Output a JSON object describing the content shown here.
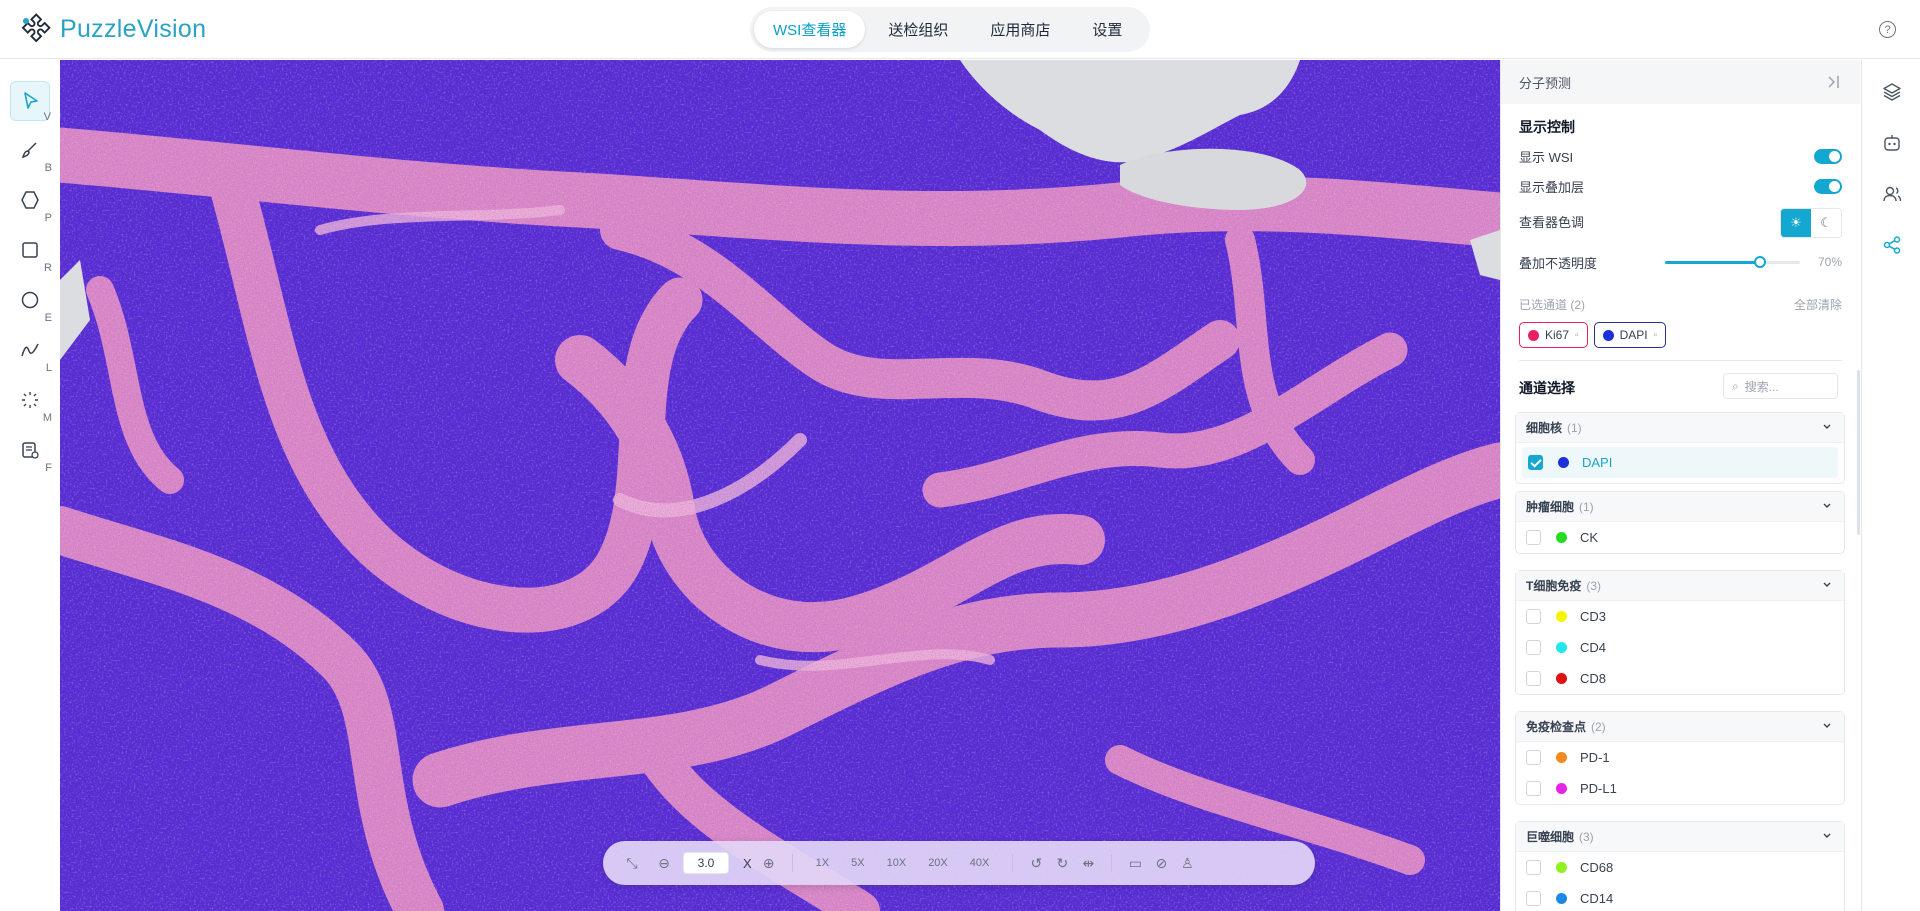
{
  "app": {
    "name": "PuzzleVision",
    "help_icon": "help-circle-icon"
  },
  "nav": {
    "tabs": [
      {
        "label": "WSI查看器",
        "active": true
      },
      {
        "label": "送检组织",
        "active": false
      },
      {
        "label": "应用商店",
        "active": false
      },
      {
        "label": "设置",
        "active": false
      }
    ]
  },
  "tools": [
    {
      "key": "V",
      "icon": "pointer-icon",
      "active": true
    },
    {
      "key": "B",
      "icon": "brush-icon",
      "active": false
    },
    {
      "key": "P",
      "icon": "polygon-icon",
      "active": false
    },
    {
      "key": "R",
      "icon": "rectangle-icon",
      "active": false
    },
    {
      "key": "E",
      "icon": "ellipse-icon",
      "active": false
    },
    {
      "key": "L",
      "icon": "line-icon",
      "active": false
    },
    {
      "key": "M",
      "icon": "magic-wand-icon",
      "active": false
    },
    {
      "key": "F",
      "icon": "fill-icon",
      "active": false
    }
  ],
  "zoombar": {
    "zoom_value": "3.0",
    "zoom_unit": "X",
    "magnifications": [
      "1X",
      "5X",
      "10X",
      "20X",
      "40X"
    ]
  },
  "panel": {
    "header": "分子预测",
    "display_title": "显示控制",
    "show_wsi_label": "显示 WSI",
    "show_wsi": true,
    "show_overlay_label": "显示叠加层",
    "show_overlay": true,
    "theme_label": "查看器色调",
    "theme": "light",
    "opacity_label": "叠加不透明度",
    "opacity_text": "70%",
    "opacity": 0.7,
    "selected_label": "已选通道 (2)",
    "clear_all": "全部清除",
    "selected_channels": [
      {
        "name": "Ki67",
        "color": "#e91e63"
      },
      {
        "name": "DAPI",
        "color": "#1d2fd8"
      }
    ],
    "channel_title": "通道选择",
    "search_placeholder": "搜索...",
    "groups": [
      {
        "title": "细胞核",
        "count": "(1)",
        "channels": [
          {
            "name": "DAPI",
            "color": "#1d2fd8",
            "checked": true
          }
        ]
      },
      {
        "title": "肿瘤细胞",
        "count": "(1)",
        "channels": [
          {
            "name": "CK",
            "color": "#22dd22",
            "checked": false
          }
        ]
      },
      {
        "title": "T细胞免疫",
        "count": "(3)",
        "channels": [
          {
            "name": "CD3",
            "color": "#f5f500",
            "checked": false
          },
          {
            "name": "CD4",
            "color": "#22e6ee",
            "checked": false
          },
          {
            "name": "CD8",
            "color": "#e01010",
            "checked": false
          }
        ]
      },
      {
        "title": "免疫检查点",
        "count": "(2)",
        "channels": [
          {
            "name": "PD-1",
            "color": "#f28a1e",
            "checked": false
          },
          {
            "name": "PD-L1",
            "color": "#e623e6",
            "checked": false
          }
        ]
      },
      {
        "title": "巨噬细胞",
        "count": "(3)",
        "channels": [
          {
            "name": "CD68",
            "color": "#8ef21e",
            "checked": false
          },
          {
            "name": "CD14",
            "color": "#1e88e5",
            "checked": false
          }
        ]
      }
    ]
  },
  "colors": {
    "accent": "#14a7cf",
    "brand": "#29a3c4",
    "tissue_nuclei": "#4b22c9",
    "tissue_stroma": "#e58fc4"
  }
}
